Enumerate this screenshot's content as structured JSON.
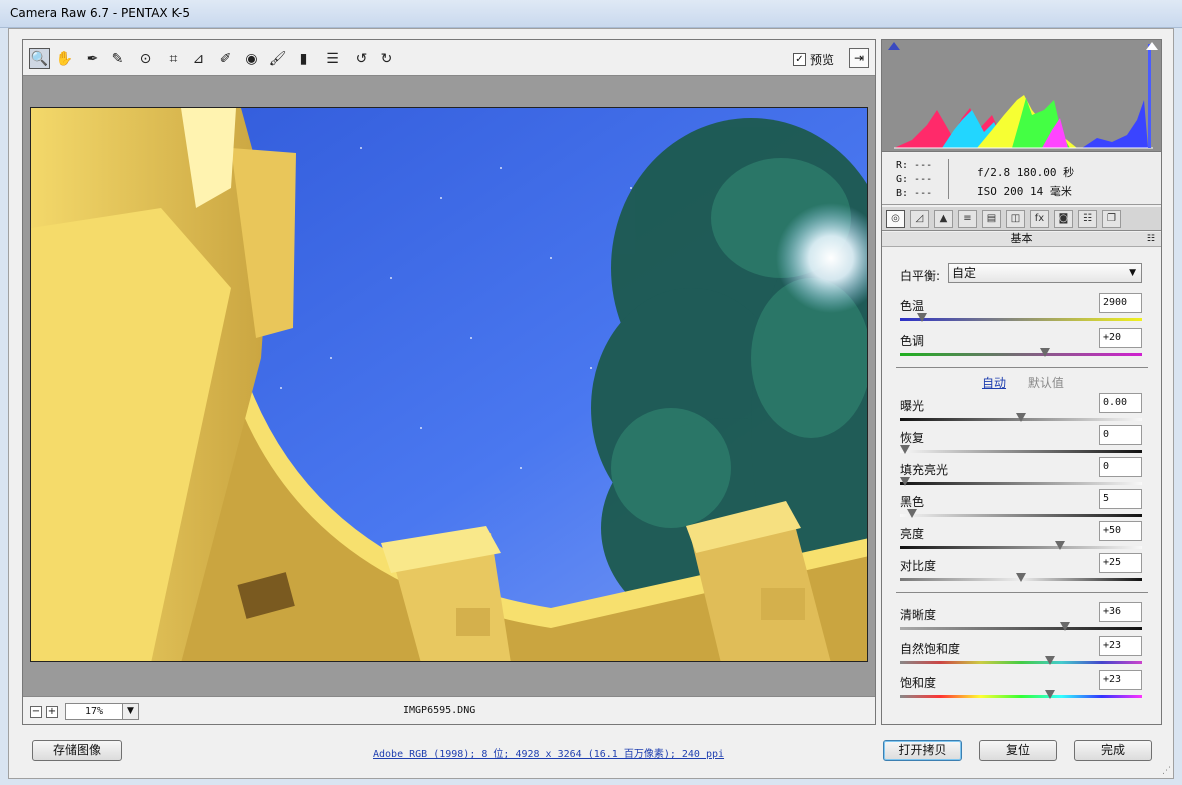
{
  "window": {
    "title": "Camera Raw 6.7 -  PENTAX K-5"
  },
  "toolbar": {
    "tools": [
      {
        "name": "zoom-tool-icon",
        "glyph": "🔍"
      },
      {
        "name": "hand-tool-icon",
        "glyph": "✋"
      },
      {
        "name": "white-balance-tool-icon",
        "glyph": "✒"
      },
      {
        "name": "color-sampler-tool-icon",
        "glyph": "✎"
      },
      {
        "name": "targeted-adjustment-tool-icon",
        "glyph": "⊙"
      },
      {
        "name": "crop-tool-icon",
        "glyph": "⌗"
      },
      {
        "name": "straighten-tool-icon",
        "glyph": "⊿"
      },
      {
        "name": "spot-removal-tool-icon",
        "glyph": "✐"
      },
      {
        "name": "red-eye-tool-icon",
        "glyph": "◉"
      },
      {
        "name": "adjustment-brush-icon",
        "glyph": "🖌"
      },
      {
        "name": "graduated-filter-icon",
        "glyph": "▮"
      },
      {
        "name": "preferences-icon",
        "glyph": "☰"
      },
      {
        "name": "rotate-left-icon",
        "glyph": "↺"
      },
      {
        "name": "rotate-right-icon",
        "glyph": "↻"
      }
    ],
    "preview_label": "预览",
    "preview_check": "✓",
    "exit_glyph": "⇥"
  },
  "status": {
    "zoom_out": "−",
    "zoom_in": "+",
    "zoom": "17%",
    "zoom_arrow": "▼",
    "filename": "IMGP6595.DNG"
  },
  "readout": {
    "r": "R:  ---",
    "g": "G:  ---",
    "b": "B:  ---",
    "aperture_shutter": "f/2.8   180.00 秒",
    "iso_focal": "ISO 200   14 毫米"
  },
  "panel": {
    "tab_glyphs": [
      "◎",
      "◿",
      "▲",
      "≡",
      "▤",
      "◫",
      "fx",
      "◙",
      "☷",
      "❐"
    ],
    "section_title": "基本",
    "section_menu": "☷",
    "wb_label": "白平衡:",
    "wb_value": "自定",
    "wb_arrow": "▼",
    "auto": "自动",
    "default": "默认值"
  },
  "sliders": [
    {
      "key": "temp",
      "label": "色温",
      "value": "2900",
      "pos": 0.09
    },
    {
      "key": "tint",
      "label": "色调",
      "value": "+20",
      "pos": 0.6
    },
    {
      "key": "exposure",
      "label": "曝光",
      "value": "0.00",
      "pos": 0.5
    },
    {
      "key": "recovery",
      "label": "恢复",
      "value": "0",
      "pos": 0.0
    },
    {
      "key": "fill",
      "label": "填充亮光",
      "value": "0",
      "pos": 0.0
    },
    {
      "key": "blacks",
      "label": "黑色",
      "value": "5",
      "pos": 0.05
    },
    {
      "key": "brightness",
      "label": "亮度",
      "value": "+50",
      "pos": 0.66
    },
    {
      "key": "contrast",
      "label": "对比度",
      "value": "+25",
      "pos": 0.5
    },
    {
      "key": "clarity",
      "label": "清晰度",
      "value": "+36",
      "pos": 0.68
    },
    {
      "key": "vibrance",
      "label": "自然饱和度",
      "value": "+23",
      "pos": 0.62
    },
    {
      "key": "saturation",
      "label": "饱和度",
      "value": "+23",
      "pos": 0.62
    }
  ],
  "bottom": {
    "save": "存储图像",
    "workflow": "Adobe RGB (1998); 8 位; 4928 x 3264 (16.1 百万像素); 240 ppi",
    "open_copy": "打开拷贝",
    "reset": "复位",
    "done": "完成",
    "grip": "⋰"
  }
}
